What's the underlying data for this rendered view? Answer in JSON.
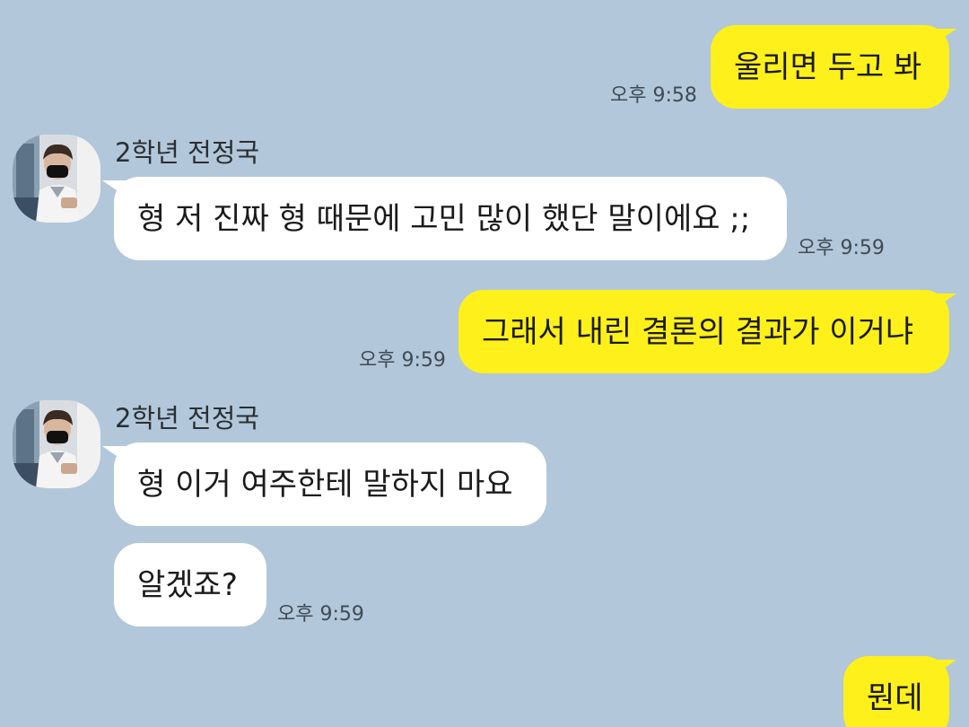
{
  "messages": [
    {
      "id": "m1",
      "direction": "outgoing",
      "text": "울리면 두고 봐",
      "time": "오후 9:58"
    },
    {
      "id": "m2",
      "direction": "incoming",
      "sender": "2학년 전정국",
      "text": "형 저 진짜 형 때문에 고민 많이 했단 말이에요 ;;",
      "time": "오후 9:59"
    },
    {
      "id": "m3",
      "direction": "outgoing",
      "text": "그래서 내린 결론의 결과가 이거냐",
      "time": "오후 9:59"
    },
    {
      "id": "m4",
      "direction": "incoming",
      "sender": "2학년 전정국",
      "text": "형 이거 여주한테 말하지 마요"
    },
    {
      "id": "m5",
      "direction": "incoming",
      "text": "알겠죠?",
      "time": "오후 9:59"
    },
    {
      "id": "m6",
      "direction": "outgoing",
      "text": "뭔데"
    }
  ],
  "colors": {
    "background": "#b2c7da",
    "outgoing_bubble": "#fef01b",
    "incoming_bubble": "#ffffff"
  },
  "icons": {
    "avatar": "profile-photo"
  }
}
